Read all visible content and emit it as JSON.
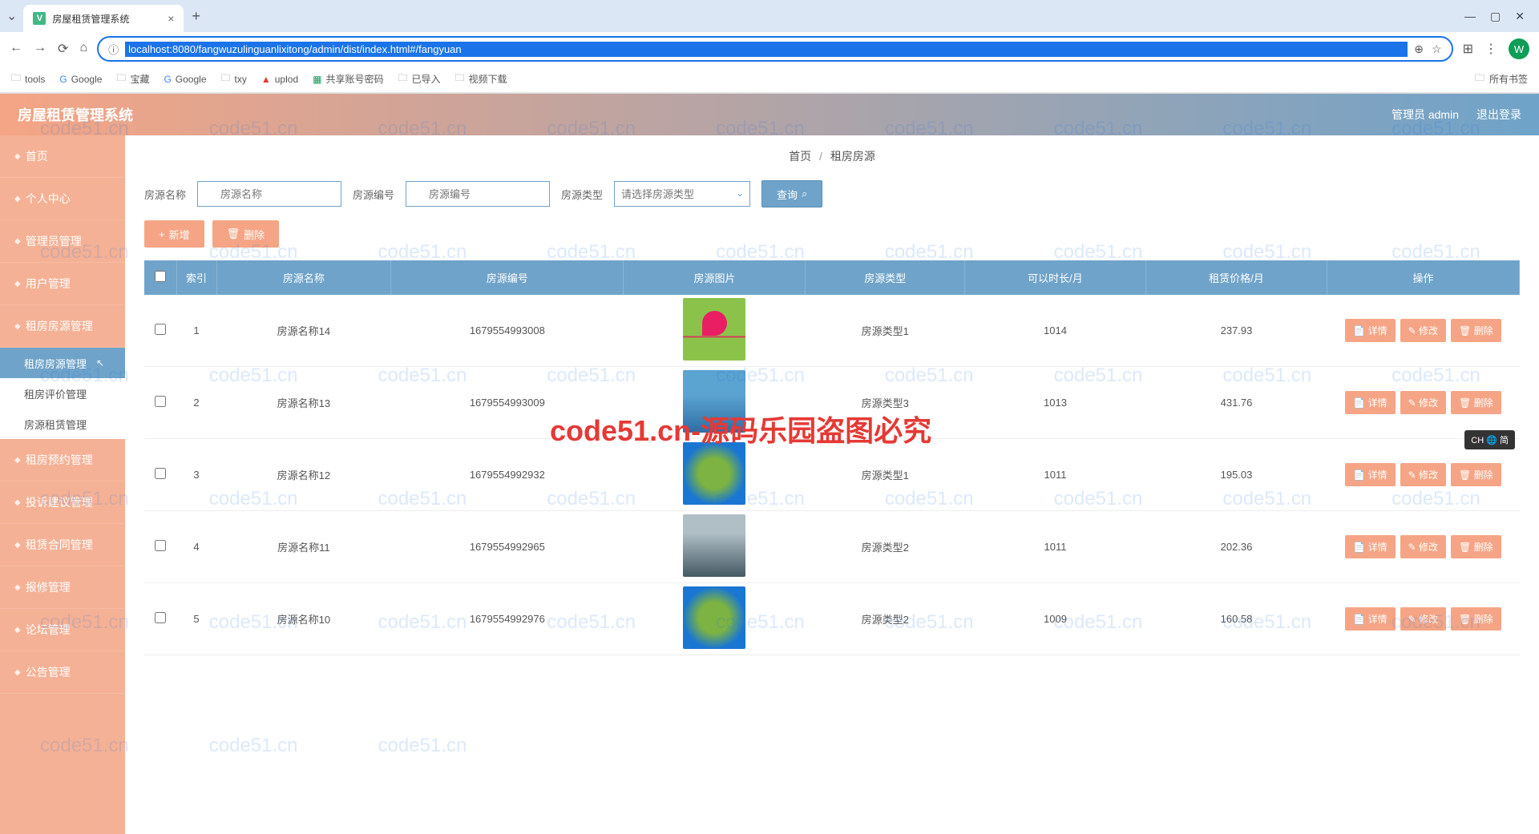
{
  "browser": {
    "tab_title": "房屋租赁管理系统",
    "url": "localhost:8080/fangwuzulinguanlixitong/admin/dist/index.html#/fangyuan",
    "bookmarks": [
      "tools",
      "Google",
      "宝藏",
      "Google",
      "txy",
      "uplod",
      "共享账号密码",
      "已导入",
      "视频下载"
    ],
    "bookmarks_right": "所有书签"
  },
  "app": {
    "title": "房屋租赁管理系统",
    "user_label": "管理员 admin",
    "logout": "退出登录"
  },
  "sidebar": {
    "items": [
      {
        "label": "首页"
      },
      {
        "label": "个人中心"
      },
      {
        "label": "管理员管理"
      },
      {
        "label": "用户管理"
      },
      {
        "label": "租房房源管理",
        "expanded": true,
        "children": [
          {
            "label": "租房房源管理",
            "active": true
          },
          {
            "label": "租房评价管理"
          },
          {
            "label": "房源租赁管理"
          }
        ]
      },
      {
        "label": "租房预约管理"
      },
      {
        "label": "投诉建议管理"
      },
      {
        "label": "租赁合同管理"
      },
      {
        "label": "报修管理"
      },
      {
        "label": "论坛管理"
      },
      {
        "label": "公告管理"
      }
    ]
  },
  "breadcrumb": {
    "home": "首页",
    "current": "租房房源"
  },
  "filters": {
    "name_label": "房源名称",
    "name_placeholder": "房源名称",
    "code_label": "房源编号",
    "code_placeholder": "房源编号",
    "type_label": "房源类型",
    "type_placeholder": "请选择房源类型",
    "query_btn": "查询"
  },
  "actions": {
    "add": "新增",
    "delete": "删除"
  },
  "table": {
    "headers": [
      "",
      "索引",
      "房源名称",
      "房源编号",
      "房源图片",
      "房源类型",
      "可以时长/月",
      "租赁价格/月",
      "操作"
    ],
    "rows": [
      {
        "idx": "1",
        "name": "房源名称14",
        "code": "1679554993008",
        "type": "房源类型1",
        "duration": "1014",
        "price": "237.93"
      },
      {
        "idx": "2",
        "name": "房源名称13",
        "code": "1679554993009",
        "type": "房源类型3",
        "duration": "1013",
        "price": "431.76"
      },
      {
        "idx": "3",
        "name": "房源名称12",
        "code": "1679554992932",
        "type": "房源类型1",
        "duration": "1011",
        "price": "195.03"
      },
      {
        "idx": "4",
        "name": "房源名称11",
        "code": "1679554992965",
        "type": "房源类型2",
        "duration": "1011",
        "price": "202.36"
      },
      {
        "idx": "5",
        "name": "房源名称10",
        "code": "1679554992976",
        "type": "房源类型2",
        "duration": "1009",
        "price": "160.58"
      }
    ],
    "op_detail": "详情",
    "op_edit": "修改",
    "op_delete": "删除"
  },
  "watermark": "code51.cn",
  "watermark_red": "code51.cn-源码乐园盗图必究",
  "ime_badge": "CH 🌐 简"
}
